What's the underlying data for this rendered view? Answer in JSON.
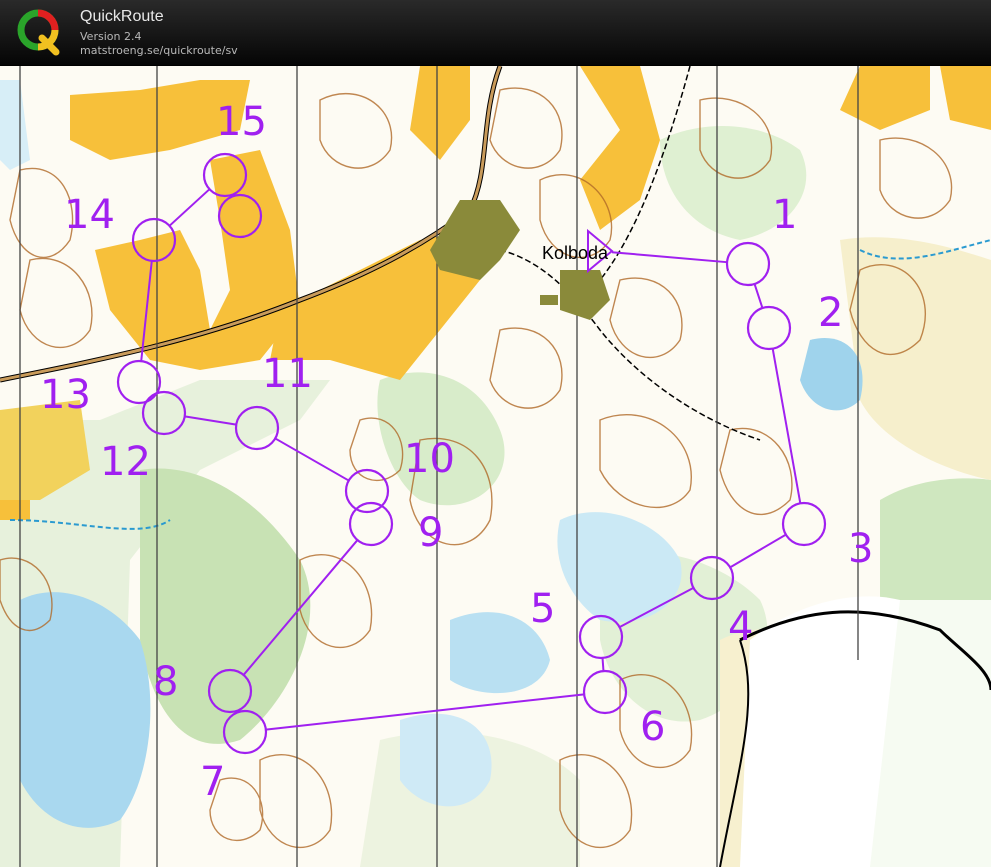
{
  "app": {
    "name": "QuickRoute",
    "version": "Version 2.4",
    "url": "matstroeng.se/quickroute/sv"
  },
  "colors": {
    "course": "#a020f0",
    "open_land": "#f7c03a",
    "forest_green": "#c6e3b4",
    "water": "#6fc3e6",
    "contour": "#b06a28",
    "building": "#8a8a3a"
  },
  "map": {
    "place_name": "Kolboda",
    "controls": [
      {
        "number": "1"
      },
      {
        "number": "2"
      },
      {
        "number": "3"
      },
      {
        "number": "4"
      },
      {
        "number": "5"
      },
      {
        "number": "6"
      },
      {
        "number": "7"
      },
      {
        "number": "8"
      },
      {
        "number": "9"
      },
      {
        "number": "10"
      },
      {
        "number": "11"
      },
      {
        "number": "12"
      },
      {
        "number": "13"
      },
      {
        "number": "14"
      },
      {
        "number": "15"
      }
    ]
  }
}
